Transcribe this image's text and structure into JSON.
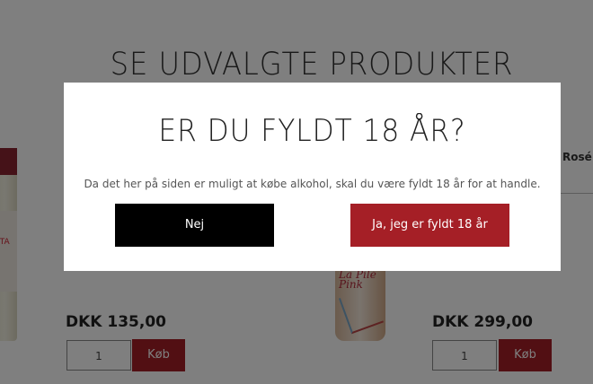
{
  "page": {
    "section_title": "SE UDVALGTE PRODUKTER",
    "category_label": "Rosé",
    "product_left_bottle_text": "ETA",
    "product_mid_bottle_text": "La Pilé Pink"
  },
  "products": [
    {
      "price": "DKK 135,00",
      "quantity": "1",
      "buy_label": "Køb"
    },
    {
      "price": "DKK 299,00",
      "quantity": "1",
      "buy_label": "Køb"
    }
  ],
  "age_modal": {
    "title": "ER DU FYLDT 18 ÅR?",
    "message": "Da det her på siden er muligt at købe alkohol, skal du være fyldt 18 år for at handle.",
    "no_label": "Nej",
    "yes_label": "Ja, jeg er fyldt 18 år"
  },
  "colors": {
    "accent": "#a51f26",
    "overlay": "#000000",
    "no_button": "#000000"
  }
}
